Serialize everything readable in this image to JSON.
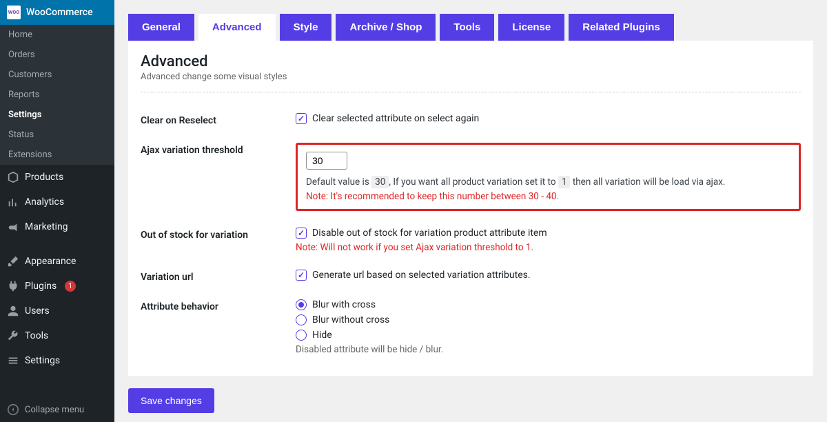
{
  "sidebar": {
    "wc": {
      "icon": "woo",
      "title": "WooCommerce"
    },
    "wc_items": [
      {
        "label": "Home",
        "active": false
      },
      {
        "label": "Orders",
        "active": false
      },
      {
        "label": "Customers",
        "active": false
      },
      {
        "label": "Reports",
        "active": false
      },
      {
        "label": "Settings",
        "active": true
      },
      {
        "label": "Status",
        "active": false
      },
      {
        "label": "Extensions",
        "active": false
      }
    ],
    "nav": [
      {
        "icon": "box",
        "label": "Products"
      },
      {
        "icon": "chart",
        "label": "Analytics"
      },
      {
        "icon": "megaphone",
        "label": "Marketing"
      },
      {
        "icon": "brush",
        "label": "Appearance"
      },
      {
        "icon": "plugin",
        "label": "Plugins",
        "badge": "1"
      },
      {
        "icon": "user",
        "label": "Users"
      },
      {
        "icon": "wrench",
        "label": "Tools"
      },
      {
        "icon": "sliders",
        "label": "Settings"
      }
    ],
    "collapse": "Collapse menu"
  },
  "tabs": [
    {
      "label": "General",
      "active": false
    },
    {
      "label": "Advanced",
      "active": true
    },
    {
      "label": "Style",
      "active": false
    },
    {
      "label": "Archive / Shop",
      "active": false
    },
    {
      "label": "Tools",
      "active": false
    },
    {
      "label": "License",
      "active": false
    },
    {
      "label": "Related Plugins",
      "active": false
    }
  ],
  "panel": {
    "title": "Advanced",
    "desc": "Advanced change some visual styles"
  },
  "fields": {
    "clear_reselect": {
      "label": "Clear on Reselect",
      "text": "Clear selected attribute on select again"
    },
    "ajax_threshold": {
      "label": "Ajax variation threshold",
      "value": "30",
      "help_pre": "Default value is ",
      "help_code1": "30",
      "help_mid": ", If you want all product variation set it to ",
      "help_code2": "1",
      "help_post": " then all variation will be load via ajax.",
      "note": "Note: It's recommended to keep this number between 30 - 40."
    },
    "out_of_stock": {
      "label": "Out of stock for variation",
      "text": "Disable out of stock for variation product attribute item",
      "note": "Note: Will not work if you set Ajax variation threshold to 1."
    },
    "variation_url": {
      "label": "Variation url",
      "text": "Generate url based on selected variation attributes."
    },
    "attr_behavior": {
      "label": "Attribute behavior",
      "options": [
        {
          "label": "Blur with cross",
          "checked": true
        },
        {
          "label": "Blur without cross",
          "checked": false
        },
        {
          "label": "Hide",
          "checked": false
        }
      ],
      "help": "Disabled attribute will be hide / blur."
    }
  },
  "save_label": "Save changes"
}
